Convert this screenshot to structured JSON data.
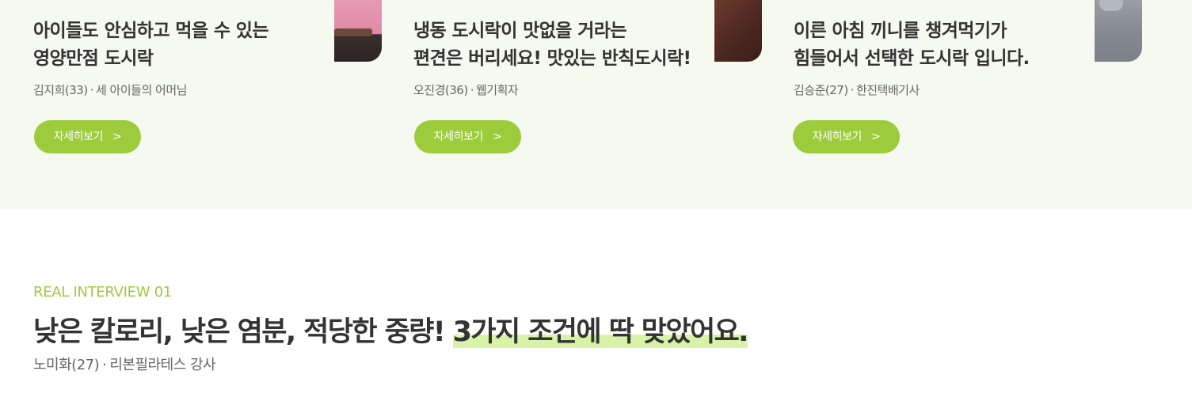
{
  "reviews": [
    {
      "title": "아이들도 안심하고 먹을 수 있는\n영양만점 도시락",
      "author_name": "김지희(33)",
      "author_role": "세 아이들의 어머님",
      "button_label": "자세히보기",
      "image": "photo-pink"
    },
    {
      "title": "냉동 도시락이 맛없을 거라는\n편견은 버리세요! 맛있는 반칙도시락!",
      "author_name": "오진경(36)",
      "author_role": "웹기획자",
      "button_label": "자세히보기",
      "image": "photo-brown"
    },
    {
      "title": "이른 아침 끼니를 챙겨먹기가\n힘들어서 선택한 도시락 입니다.",
      "author_name": "김승준(27)",
      "author_role": "한진택배기사",
      "button_label": "자세히보기",
      "image": "photo-gray"
    }
  ],
  "separator": "·",
  "chevron": ">",
  "interview": {
    "label": "REAL INTERVIEW 01",
    "headline_plain": "낮은 칼로리, 낮은 염분, 적당한 중량! ",
    "headline_highlight": "3가지 조건에 딱 맞았어요.",
    "author_name": "노미화(27)",
    "author_role": "리본필라테스 강사"
  },
  "colors": {
    "accent": "#9ccc3c",
    "highlight": "#d8f2a8",
    "band_background": "#f6f9ef",
    "text_dark": "#333333",
    "text_muted": "#666666"
  }
}
